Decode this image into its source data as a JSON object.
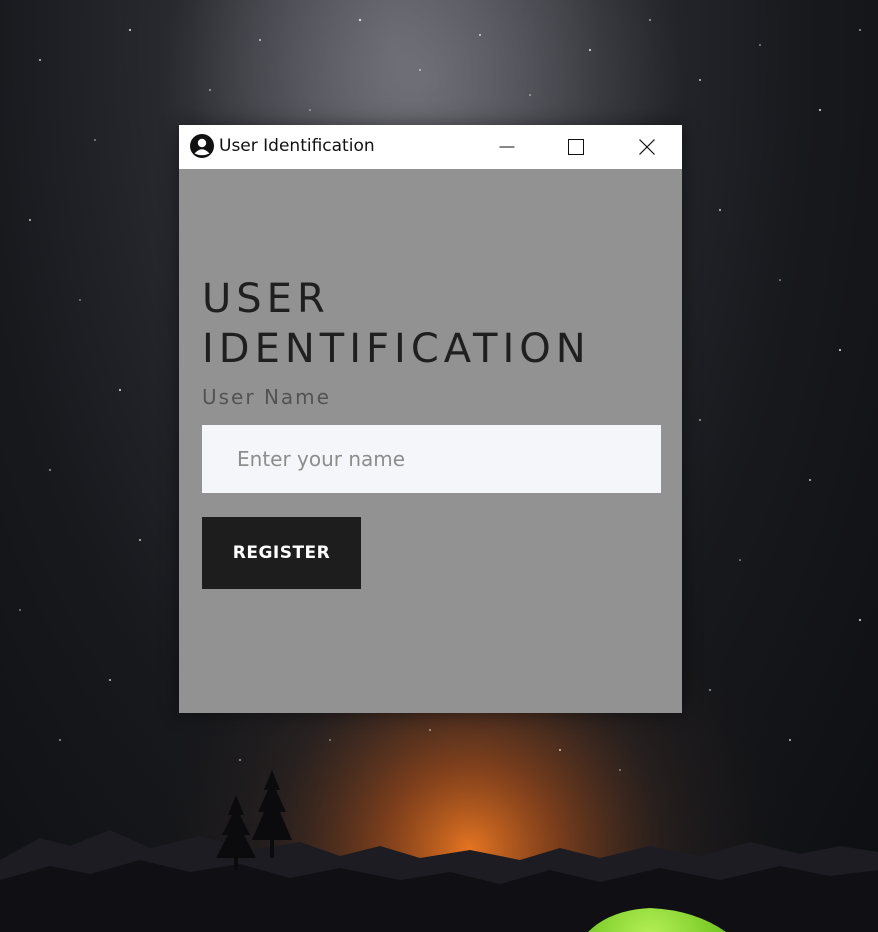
{
  "window": {
    "title": "User Identification",
    "icon": "user-circle-icon"
  },
  "controls": {
    "minimize_icon": "minimize-icon",
    "maximize_icon": "maximize-icon",
    "close_icon": "close-icon"
  },
  "form": {
    "heading_line1": "USER",
    "heading_line2": "IDENTIFICATION",
    "label": "User Name",
    "placeholder": "Enter your name",
    "value": "",
    "submit_label": "REGISTER"
  },
  "colors": {
    "panel_bg": "#929292",
    "input_bg": "#f5f6f9",
    "button_bg": "#1d1d1d",
    "heading": "#1f1f1f",
    "tent_green": "#7ed321"
  }
}
